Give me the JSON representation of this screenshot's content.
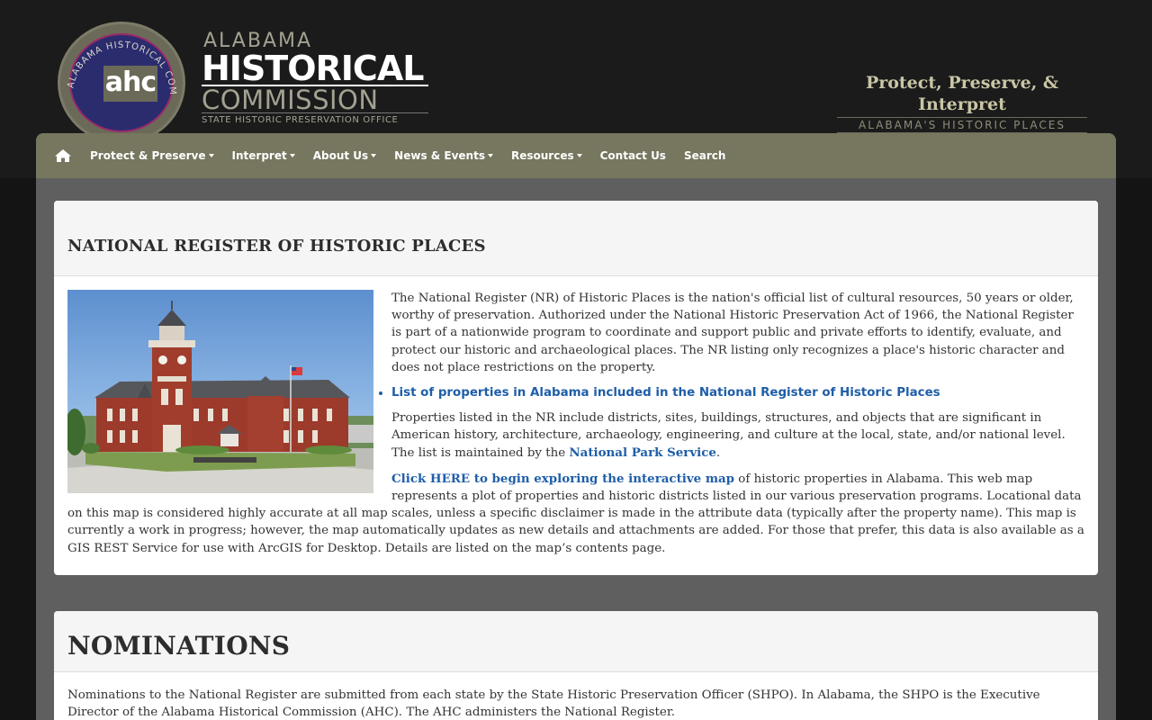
{
  "header": {
    "seal_text": "ALABAMA HISTORICAL COMMISSION",
    "seal_monogram": "ahc",
    "logo_line1": "ALABAMA",
    "logo_line2": "HISTORICAL",
    "logo_line3": "COMMISSION",
    "logo_line4": "STATE HISTORIC PRESERVATION OFFICE",
    "tagline_main": "Protect, Preserve, & Interpret",
    "tagline_sub": "ALABAMA'S HISTORIC PLACES"
  },
  "nav": {
    "home_icon": "home-icon",
    "items": [
      {
        "label": "Protect & Preserve",
        "dropdown": true
      },
      {
        "label": "Interpret",
        "dropdown": true
      },
      {
        "label": "About Us",
        "dropdown": true
      },
      {
        "label": "News & Events",
        "dropdown": true
      },
      {
        "label": "Resources",
        "dropdown": true
      },
      {
        "label": "Contact Us",
        "dropdown": false
      },
      {
        "label": "Search",
        "dropdown": false
      }
    ]
  },
  "nr_panel": {
    "title": "NATIONAL REGISTER OF HISTORIC PLACES",
    "intro": "The National Register (NR) of Historic Places is the nation's official list of cultural resources, 50 years or older, worthy of preservation. Authorized under the National Historic Preservation Act of 1966, the National Register is part of a nationwide program to coordinate and support public and private efforts to identify, evaluate, and protect our historic and archaeological places. The NR listing only recognizes a place's historic character and does not place restrictions on the property.",
    "list_link": "List of properties in Alabama included in the National Register of Historic Places",
    "para2_before": "Properties listed in the NR include districts, sites, buildings, structures, and objects that are significant in American history, architecture, archaeology, engineering, and culture at the local, state, and/or national level. The list is maintained by the ",
    "para2_link": "National Park Service",
    "para2_after": ".",
    "para3_link": "Click HERE to begin exploring the interactive map",
    "para3_text": " of historic properties in Alabama. This web map represents a plot of properties and historic districts listed in our various preservation programs. Locational data on this map is considered highly accurate at all map scales, unless a specific disclaimer is made in the attribute data (typically after the property name). This map is currently a work in progress; however, the map automatically updates as new details and attachments are added. For those that prefer, this data is also available as a GIS REST Service for use with ArcGIS for Desktop. Details are listed on the map’s contents page."
  },
  "nominations_panel": {
    "title": "NOMINATIONS",
    "text": "Nominations to the National Register are submitted from each state by the State Historic Preservation Officer (SHPO). In Alabama, the SHPO is the Executive Director of the Alabama Historical Commission (AHC). The AHC administers the National Register."
  },
  "colors": {
    "header_bg": "#1b1b1b",
    "nav_bg": "#77765f",
    "link": "#1f5ea8",
    "seal_inner": "#2b2c6e"
  }
}
